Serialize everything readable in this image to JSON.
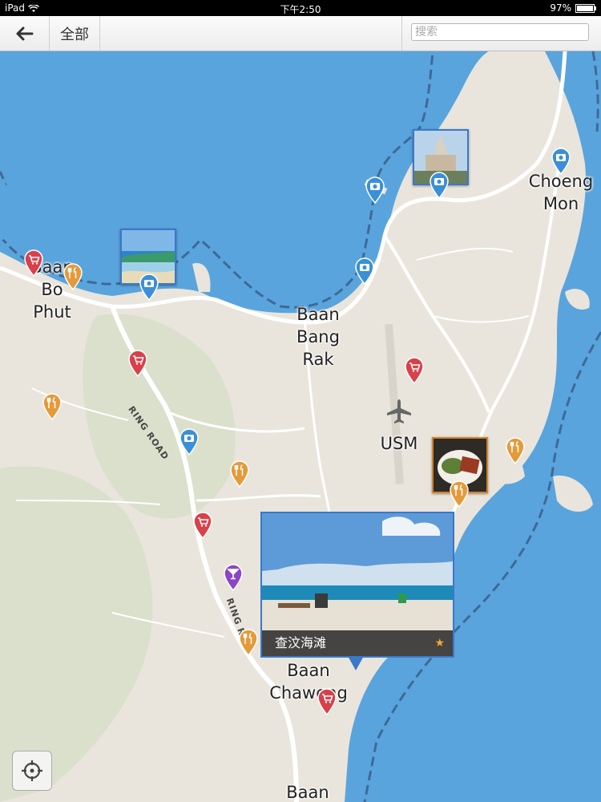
{
  "status_bar": {
    "device": "iPad",
    "time": "下午2:50",
    "battery": "97%"
  },
  "toolbar": {
    "back_icon": "back-arrow-icon",
    "filter_label": "全部",
    "search_placeholder": "搜索"
  },
  "map": {
    "colors": {
      "water": "#5aa4dd",
      "land": "#e9e5dc",
      "road": "#ffffff",
      "greenery": "#d7dfc8"
    },
    "place_labels": {
      "bo_phut": "Baan\nBo\nPhut",
      "bang_rak": "Baan\nBang\nRak",
      "choeng_mon": "Choeng\nMon",
      "airport": "USM",
      "chaweng": "Baan\nChaweng",
      "baan_bottom": "Baan"
    },
    "road_labels": {
      "ring_road_1": "RING ROAD",
      "ring_road_2": "RING R"
    },
    "pin_types": {
      "camera": "#3b8fd8",
      "shopping": "#d9414a",
      "restaurant": "#e59a3a",
      "nightlife": "#8b45c6"
    }
  },
  "popup": {
    "title": "查汶海滩",
    "starred": true,
    "star": "★"
  },
  "controls": {
    "locate_icon": "crosshair-icon"
  }
}
